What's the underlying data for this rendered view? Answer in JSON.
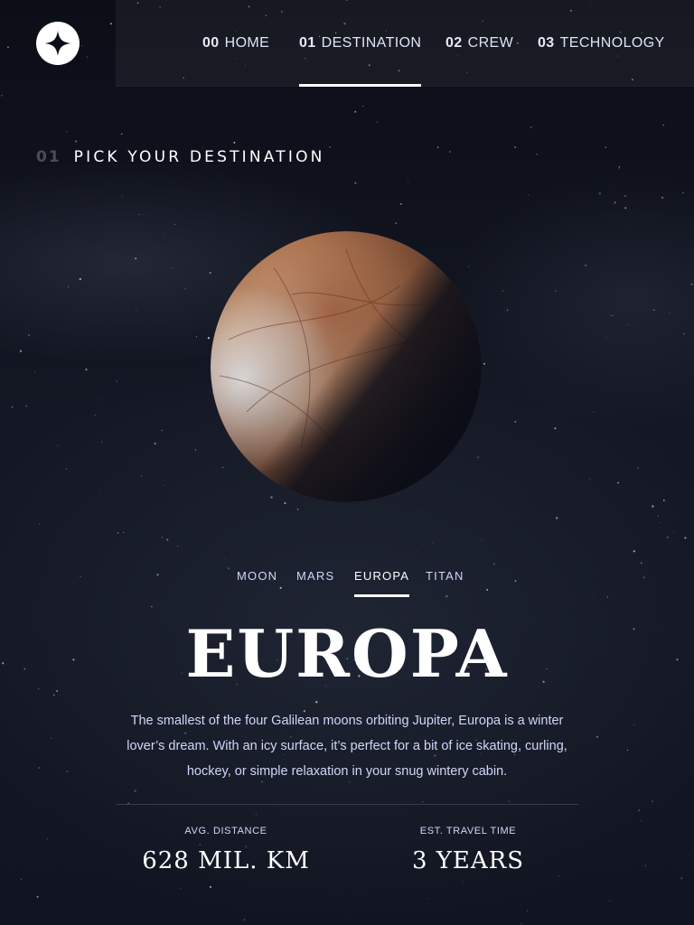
{
  "logo": {
    "icon": "star-logo-icon"
  },
  "nav": {
    "items": [
      {
        "num": "00",
        "label": "HOME"
      },
      {
        "num": "01",
        "label": "DESTINATION"
      },
      {
        "num": "02",
        "label": "CREW"
      },
      {
        "num": "03",
        "label": "TECHNOLOGY"
      }
    ],
    "active": "DESTINATION"
  },
  "heading": {
    "num": "01",
    "text": "PICK YOUR DESTINATION"
  },
  "destinations": {
    "tabs": [
      "MOON",
      "MARS",
      "EUROPA",
      "TITAN"
    ],
    "active": "EUROPA"
  },
  "planet": {
    "name": "EUROPA",
    "description": "The smallest of the four Galilean moons orbiting Jupiter, Europa is a winter lover’s dream. With an icy surface, it’s perfect for a bit of ice skating, curling, hockey, or simple relaxation in your snug wintery cabin.",
    "stats": [
      {
        "label": "AVG. DISTANCE",
        "value": "628 MIL. KM"
      },
      {
        "label": "EST. TRAVEL TIME",
        "value": "3 YEARS"
      }
    ]
  },
  "colors": {
    "background": "#0b0d17",
    "accent": "#d0d6f9",
    "text": "#ffffff"
  }
}
